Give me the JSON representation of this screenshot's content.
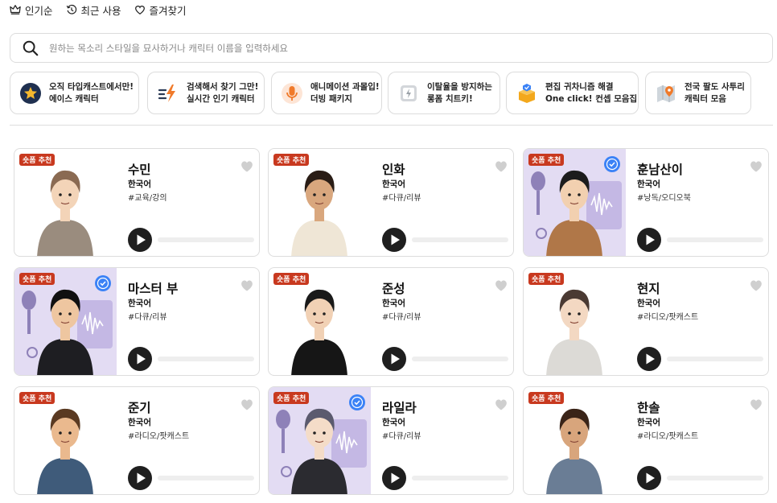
{
  "top_tabs": [
    {
      "label": "인기순",
      "icon": "crown-icon"
    },
    {
      "label": "최근 사용",
      "icon": "history-icon"
    },
    {
      "label": "즐겨찾기",
      "icon": "heart-icon"
    }
  ],
  "search": {
    "placeholder": "원하는 목소리 스타일을 묘사하거나 캐릭터 이름을 입력하세요",
    "value": ""
  },
  "chips": [
    {
      "line1": "오직 타입캐스트에서만!",
      "line2": "에이스 캐릭터",
      "icon": "star-icon"
    },
    {
      "line1": "검색해서 찾기 그만!",
      "line2": "실시간 인기 캐릭터",
      "icon": "lightning-icon"
    },
    {
      "line1": "애니메이션 과몰입!",
      "line2": "더빙 패키지",
      "icon": "microphone-icon"
    },
    {
      "line1": "이탈율을 방지하는",
      "line2": "롱폼 치트키!",
      "icon": "bolt-badge-icon"
    },
    {
      "line1": "편집 귀차니즘 해결",
      "line2": "One click! 컨셉 모음집",
      "icon": "package-icon"
    },
    {
      "line1": "전국 팔도 사투리",
      "line2": "캐릭터 모음",
      "icon": "map-icon"
    }
  ],
  "badge_label": "숏폼 추천",
  "colors": {
    "badge": "#c8391f",
    "verified": "#3b82f6",
    "studio_bg": "#e3dcf3",
    "text": "#111111"
  },
  "cards": [
    {
      "name": "수민",
      "language": "한국어",
      "tag": "#교육/강의",
      "verified": false,
      "progress": 0
    },
    {
      "name": "인화",
      "language": "한국어",
      "tag": "#다큐/리뷰",
      "verified": false,
      "progress": 0
    },
    {
      "name": "훈남산이",
      "language": "한국어",
      "tag": "#낭독/오디오북",
      "verified": true,
      "progress": 0
    },
    {
      "name": "마스터 부",
      "language": "한국어",
      "tag": "#다큐/리뷰",
      "verified": true,
      "progress": 0
    },
    {
      "name": "준성",
      "language": "한국어",
      "tag": "#다큐/리뷰",
      "verified": false,
      "progress": 0
    },
    {
      "name": "현지",
      "language": "한국어",
      "tag": "#라디오/팟캐스트",
      "verified": false,
      "progress": 0
    },
    {
      "name": "준기",
      "language": "한국어",
      "tag": "#라디오/팟캐스트",
      "verified": false,
      "progress": 0
    },
    {
      "name": "라일라",
      "language": "한국어",
      "tag": "#다큐/리뷰",
      "verified": true,
      "progress": 0
    },
    {
      "name": "한솔",
      "language": "한국어",
      "tag": "#라디오/팟캐스트",
      "verified": false,
      "progress": 0
    }
  ]
}
